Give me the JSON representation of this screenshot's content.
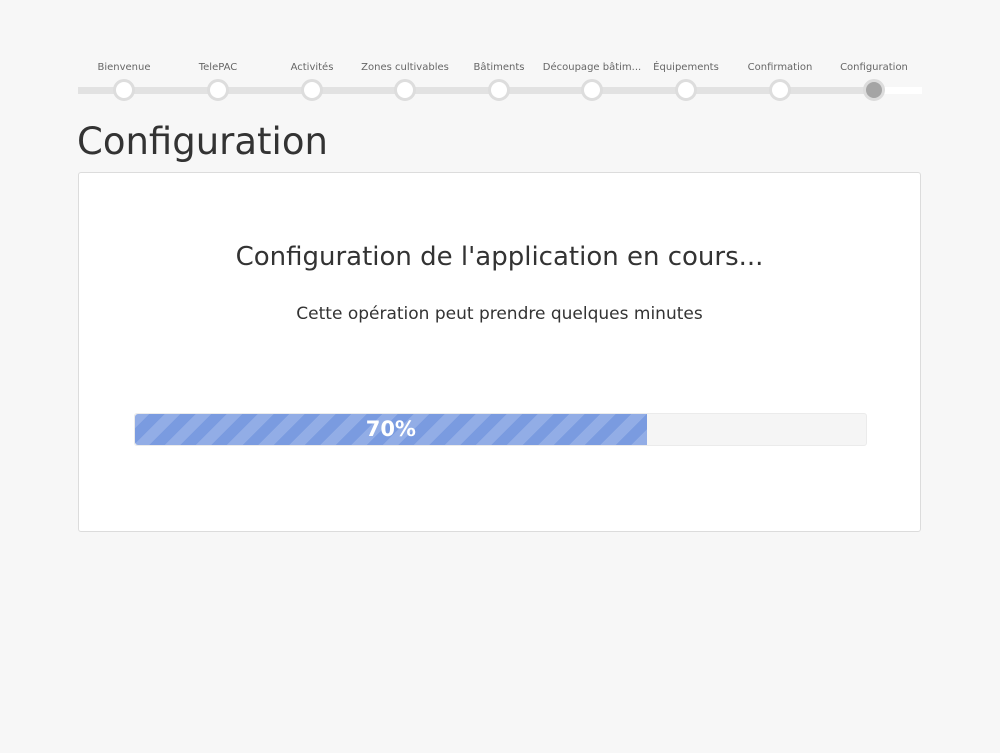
{
  "wizard": {
    "steps": [
      {
        "label": "Bienvenue"
      },
      {
        "label": "TelePAC"
      },
      {
        "label": "Activités"
      },
      {
        "label": "Zones cultivables"
      },
      {
        "label": "Bâtiments"
      },
      {
        "label": "Découpage bâtim..."
      },
      {
        "label": "Équipements"
      },
      {
        "label": "Confirmation"
      },
      {
        "label": "Configuration"
      }
    ],
    "active_step": 8
  },
  "page": {
    "title": "Configuration"
  },
  "panel": {
    "heading": "Configuration de l'application en cours...",
    "subtext": "Cette opération peut prendre quelques minutes"
  },
  "progress": {
    "value": 70,
    "label": "70%",
    "color": "#7a9be0"
  }
}
